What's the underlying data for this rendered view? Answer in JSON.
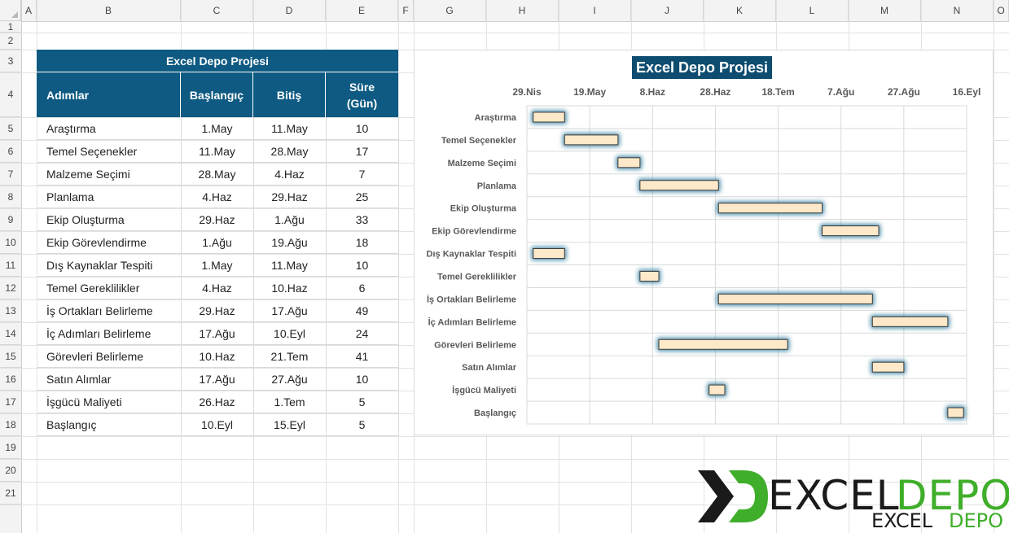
{
  "spreadsheet": {
    "columns": [
      "A",
      "B",
      "C",
      "D",
      "E",
      "F",
      "G",
      "H",
      "I",
      "J",
      "K",
      "L",
      "M",
      "N",
      "O"
    ],
    "rows": [
      "1",
      "2",
      "3",
      "4",
      "5",
      "6",
      "7",
      "8",
      "9",
      "10",
      "11",
      "12",
      "13",
      "14",
      "15",
      "16",
      "17",
      "18",
      "19",
      "20",
      "21"
    ]
  },
  "table": {
    "title": "Excel Depo Projesi",
    "headers": {
      "step": "Adımlar",
      "start": "Başlangıç",
      "end": "Bitiş",
      "duration_line1": "Süre",
      "duration_line2": "(Gün)"
    },
    "rows": [
      {
        "step": "Araştırma",
        "start": "1.May",
        "end": "11.May",
        "duration": "10"
      },
      {
        "step": "Temel Seçenekler",
        "start": "11.May",
        "end": "28.May",
        "duration": "17"
      },
      {
        "step": "Malzeme Seçimi",
        "start": "28.May",
        "end": "4.Haz",
        "duration": "7"
      },
      {
        "step": "Planlama",
        "start": "4.Haz",
        "end": "29.Haz",
        "duration": "25"
      },
      {
        "step": "Ekip Oluşturma",
        "start": "29.Haz",
        "end": "1.Ağu",
        "duration": "33"
      },
      {
        "step": "Ekip Görevlendirme",
        "start": "1.Ağu",
        "end": "19.Ağu",
        "duration": "18"
      },
      {
        "step": "Dış Kaynaklar Tespiti",
        "start": "1.May",
        "end": "11.May",
        "duration": "10"
      },
      {
        "step": "Temel Gereklilikler",
        "start": "4.Haz",
        "end": "10.Haz",
        "duration": "6"
      },
      {
        "step": "İş Ortakları Belirleme",
        "start": "29.Haz",
        "end": "17.Ağu",
        "duration": "49"
      },
      {
        "step": "İç Adımları Belirleme",
        "start": "17.Ağu",
        "end": "10.Eyl",
        "duration": "24"
      },
      {
        "step": "Görevleri Belirleme",
        "start": "10.Haz",
        "end": "21.Tem",
        "duration": "41"
      },
      {
        "step": "Satın Alımlar",
        "start": "17.Ağu",
        "end": "27.Ağu",
        "duration": "10"
      },
      {
        "step": "İşgücü Maliyeti",
        "start": "26.Haz",
        "end": "1.Tem",
        "duration": "5"
      },
      {
        "step": "Başlangıç",
        "start": "10.Eyl",
        "end": "15.Eyl",
        "duration": "5"
      }
    ]
  },
  "chart_data": {
    "type": "bar",
    "orientation": "horizontal-gantt",
    "title": "Excel Depo Projesi",
    "x_tick_labels": [
      "29.Nis",
      "19.May",
      "8.Haz",
      "28.Haz",
      "18.Tem",
      "7.Ağu",
      "27.Ağu",
      "16.Eyl"
    ],
    "x_tick_day_offsets": [
      0,
      20,
      40,
      60,
      80,
      100,
      120,
      140
    ],
    "xlim_days": [
      0,
      140
    ],
    "grid": true,
    "categories": [
      "Araştırma",
      "Temel Seçenekler",
      "Malzeme Seçimi",
      "Planlama",
      "Ekip Oluşturma",
      "Ekip Görevlendirme",
      "Dış Kaynaklar Tespiti",
      "Temel Gereklilikler",
      "İş Ortakları Belirleme",
      "İç Adımları Belirleme",
      "Görevleri Belirleme",
      "Satın Alımlar",
      "İşgücü Maliyeti",
      "Başlangıç"
    ],
    "start_day_offsets": [
      2,
      12,
      29,
      36,
      61,
      94,
      2,
      36,
      61,
      110,
      42,
      110,
      58,
      134
    ],
    "durations": [
      10,
      17,
      7,
      25,
      33,
      18,
      10,
      6,
      49,
      24,
      41,
      10,
      5,
      5
    ],
    "bar_fill": "#fde9c9",
    "bar_glow": "#1f6f94"
  },
  "colors": {
    "header_blue": "#0e5a82",
    "title_blue": "#0e4d70",
    "logo_dark": "#1a1a1a",
    "logo_green": "#3fae2a"
  },
  "logo": {
    "text_left": "EXCEL",
    "text_right": "DEPO",
    "small_left": "EXCEL",
    "small_right": "DEPO"
  }
}
